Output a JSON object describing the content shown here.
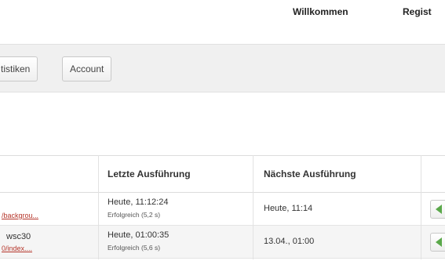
{
  "topnav": {
    "welcome": "Willkommen",
    "register": "Regist"
  },
  "tabs": {
    "statistics": "tistiken",
    "account": "Account"
  },
  "table": {
    "headers": {
      "last_run": "Letzte Ausführung",
      "next_run": "Nächste Ausführung"
    },
    "rows": [
      {
        "name": "",
        "link": "/backgrou...",
        "last_time": "Heute, 11:12:24",
        "last_status": "Erfolgreich (5,2 s)",
        "next": "Heute, 11:14"
      },
      {
        "name": "wsc30",
        "link": "0/index....",
        "last_time": "Heute, 01:00:35",
        "last_status": "Erfolgreich (5,6 s)",
        "next": "13.04., 01:00"
      }
    ]
  },
  "colors": {
    "link": "#b5352a",
    "action_icon": "#5aa84a"
  },
  "icons": {
    "action": "play-icon"
  }
}
